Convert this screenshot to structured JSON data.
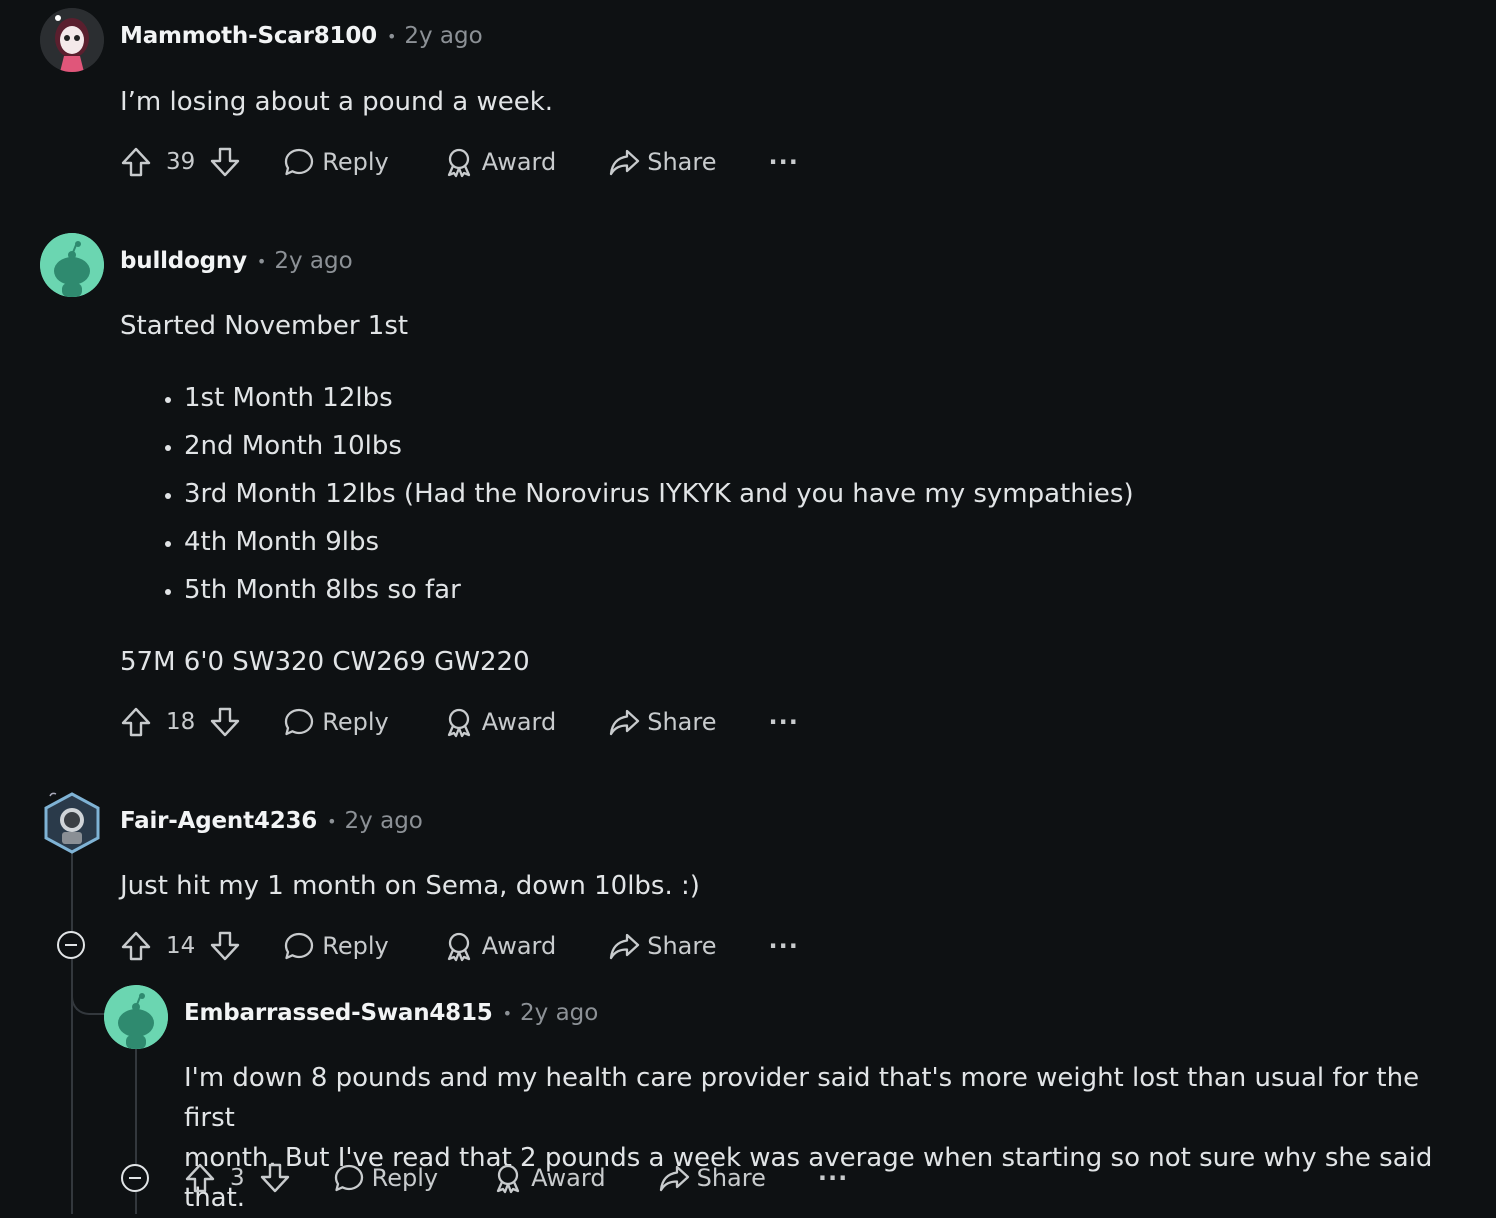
{
  "comments": [
    {
      "username": "Mammoth-Scar8100",
      "time": "2y ago",
      "body": "I’m losing about a pound a week.",
      "score": "39",
      "actions": {
        "reply": "Reply",
        "award": "Award",
        "share": "Share",
        "more": "···"
      }
    },
    {
      "username": "bulldogny",
      "time": "2y ago",
      "intro": "Started November 1st",
      "list": [
        "1st Month 12lbs",
        "2nd Month 10lbs",
        "3rd Month 12lbs (Had the Norovirus IYKYK and you have my sympathies)",
        "4th Month 9lbs",
        "5th Month 8lbs so far"
      ],
      "outro": "57M 6'0 SW320 CW269 GW220",
      "score": "18",
      "actions": {
        "reply": "Reply",
        "award": "Award",
        "share": "Share",
        "more": "···"
      }
    },
    {
      "username": "Fair-Agent4236",
      "time": "2y ago",
      "body": "Just hit my 1 month on Sema, down 10lbs. :)",
      "score": "14",
      "actions": {
        "reply": "Reply",
        "award": "Award",
        "share": "Share",
        "more": "···"
      }
    },
    {
      "username": "Embarrassed-Swan4815",
      "time": "2y ago",
      "body_line1": "I'm down 8 pounds and my health care provider said that's more weight lost than usual for the first",
      "body_line2": "month. But I've read that 2 pounds a week was average when starting so not sure why she said that.",
      "score": "3",
      "actions": {
        "reply": "Reply",
        "award": "Award",
        "share": "Share",
        "more": "···"
      }
    }
  ],
  "colors": {
    "background": "#0e1113",
    "text": "#d7dadc",
    "muted": "#8c9196",
    "snoo_avatar": "#6bd6b1"
  }
}
